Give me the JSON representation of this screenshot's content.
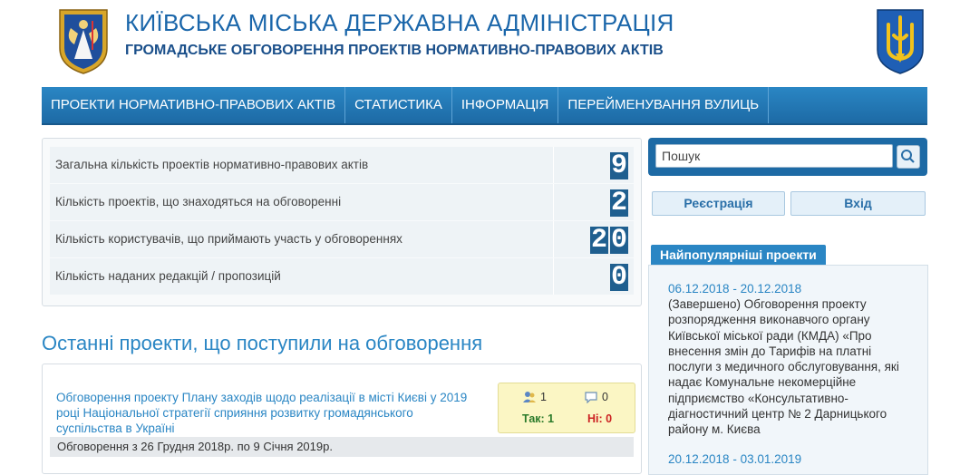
{
  "header": {
    "title": "КИЇВСЬКА МІСЬКА ДЕРЖАВНА АДМІНІСТРАЦІЯ",
    "subtitle": "ГРОМАДСЬКЕ ОБГОВОРЕННЯ ПРОЕКТІВ НОРМАТИВНО-ПРАВОВИХ АКТІВ"
  },
  "nav": {
    "items": [
      {
        "label": "ПРОЕКТИ НОРМАТИВНО-ПРАВОВИХ АКТІВ"
      },
      {
        "label": "СТАТИСТИКА"
      },
      {
        "label": "ІНФОРМАЦІЯ"
      },
      {
        "label": "ПЕРЕЙМЕНУВАННЯ ВУЛИЦЬ"
      }
    ]
  },
  "stats": [
    {
      "label": "Загальна кількість проектів нормативно-правових актів",
      "digits": [
        "9"
      ]
    },
    {
      "label": "Кількість проектів, що знаходяться на обговоренні",
      "digits": [
        "2"
      ]
    },
    {
      "label": "Кількість користувачів, що приймають участь у обговореннях",
      "digits": [
        "2",
        "0"
      ]
    },
    {
      "label": "Кількість наданих редакцій / пропозицій",
      "digits": [
        "0"
      ]
    }
  ],
  "recent": {
    "heading": "Останні проекти, що поступили на обговорення",
    "project": {
      "title": "Обговорення проекту Плану заходів щодо реалізації в місті Києві у 2019 році Національної стратегії сприяння розвитку громадянського суспільства в Україні",
      "period": "Обговорення з 26 Грудня 2018р. по 9 Січня 2019р.",
      "users": "1",
      "comments": "0",
      "yes": "Так: 1",
      "no": "Ні: 0"
    }
  },
  "sidebar": {
    "search_placeholder": "Пошук",
    "register_label": "Реєстрація",
    "login_label": "Вхід",
    "popular_title": "Найпопулярніші проекти",
    "popular": [
      {
        "date": "06.12.2018 - 20.12.2018",
        "text": "(Завершено) Обговорення проекту розпорядження виконавчого органу Київської міської ради (КМДА) «Про внесення змін до Тарифів на платні послуги з медичного обслуговування, які надає Комунальне некомерційне підприємство «Консультативно-діагностичний центр № 2 Дарницького району м. Києва"
      },
      {
        "date": "20.12.2018 - 03.01.2019"
      }
    ]
  },
  "colors": {
    "brand": "#1d6aa5",
    "link": "#2a86c4",
    "digit_bg": "#1f5f8f",
    "stats_box": "#fbf6c4",
    "no_red": "#cc2222",
    "yes_green": "#2a7a2a"
  }
}
